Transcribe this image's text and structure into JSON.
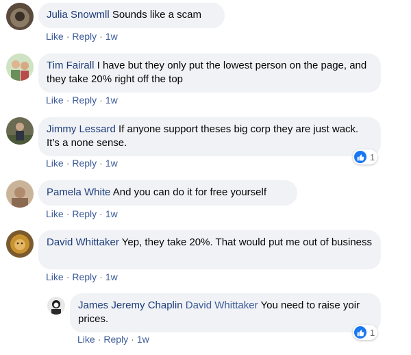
{
  "comments": [
    {
      "author": "Julia Snowmll",
      "text": "Sounds like a scam",
      "like": "Like",
      "reply": "Reply",
      "time": "1w"
    },
    {
      "author": "Tim Fairall",
      "text": "I have but they only put the lowest person on the page, and they take 20% right off the top",
      "like": "Like",
      "reply": "Reply",
      "time": "1w"
    },
    {
      "author": "Jimmy Lessard",
      "text": "If anyone support theses big corp they are just wack. It’s a none sense.",
      "like": "Like",
      "reply": "Reply",
      "time": "1w",
      "reaction_count": "1"
    },
    {
      "author": "Pamela White",
      "text": "And you can do it for free yourself",
      "like": "Like",
      "reply": "Reply",
      "time": "1w"
    },
    {
      "author": "David Whittaker",
      "text": "Yep, they take 20%. That would put me out of business",
      "like": "Like",
      "reply": "Reply",
      "time": "1w"
    }
  ],
  "reply": {
    "author": "James Jeremy Chaplin",
    "mention": "David Whittaker",
    "text": "You need to raise yoir prices.",
    "like": "Like",
    "reply": "Reply",
    "time": "1w",
    "reaction_count": "1"
  },
  "separator": "·",
  "colors": {
    "bubble": "#f0f2f5",
    "author": "#1d3c7a",
    "link": "#3b5998",
    "like_blue": "#1877f2"
  }
}
